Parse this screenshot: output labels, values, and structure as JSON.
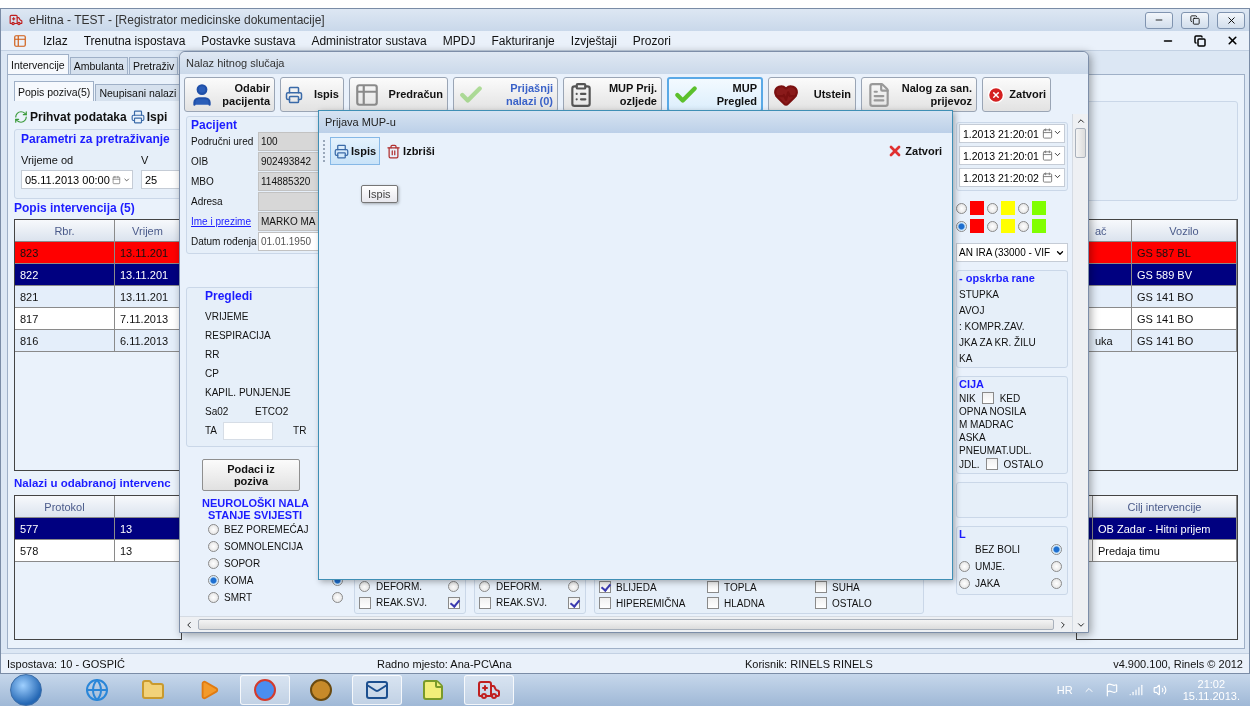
{
  "window": {
    "title": "eHitna - TEST - [Registrator medicinske dokumentacije]"
  },
  "menu": [
    "Izlaz",
    "Trenutna ispostava",
    "Postavke sustava",
    "Administrator sustava",
    "MPDJ",
    "Fakturiranje",
    "Izvještaji",
    "Prozori"
  ],
  "tabs": [
    {
      "label": "Intervencije",
      "selected": true
    },
    {
      "label": "Ambulanta",
      "selected": false
    },
    {
      "label": "Pretraživ",
      "selected": false
    }
  ],
  "subtabs": [
    {
      "label": "Popis poziva(5)",
      "selected": true
    },
    {
      "label": "Neupisani nalazi",
      "selected": false
    }
  ],
  "toolbar": [
    "Prihvat podataka",
    "Ispi"
  ],
  "search_params": {
    "title": "Parametri za pretraživanje",
    "fields": [
      {
        "label": "Vrijeme od",
        "value": "05.11.2013 00:00"
      },
      {
        "label": "V",
        "value": "25"
      }
    ]
  },
  "interventions": {
    "title": "Popis intervencija (5)",
    "columns": [
      "Rbr.",
      "Vrijem",
      "ač",
      "Vozilo"
    ],
    "rows": [
      {
        "rbr": "823",
        "vrijeme": "13.11.201",
        "vozilo": "GS 587 BL",
        "selected": false,
        "color": "#ff0000"
      },
      {
        "rbr": "822",
        "vrijeme": "13.11.201",
        "vozilo": "GS 589 BV",
        "selected": true
      },
      {
        "rbr": "821",
        "vrijeme": "13.11.201",
        "vozilo": "GS 141 BO",
        "selected": false
      },
      {
        "rbr": "817",
        "vrijeme": "7.11.2013",
        "vozilo": "GS 141 BO",
        "selected": false
      },
      {
        "rbr": "816",
        "vrijeme": "6.11.2013",
        "column_3": "uka",
        "vozilo": "GS 141 BO",
        "selected": false
      }
    ]
  },
  "findings": {
    "title": "Nalazi u odabranoj intervenc",
    "columns": [
      "Protokol",
      "Cilj intervencije"
    ],
    "rows": [
      {
        "protokol": "577",
        "column_2": "13",
        "cilj": "OB Zadar - Hitni prijem",
        "selected": true
      },
      {
        "protokol": "578",
        "column_2": "13",
        "cilj": "Predaja timu",
        "selected": false
      }
    ]
  },
  "status_bar": [
    "Ispostava: 10 - GOSPIĆ",
    "Radno mjesto: Ana-PC\\Ana",
    "Korisnik: RINELS RINELS",
    "v4.900.100, Rinels © 2012"
  ],
  "dialog": {
    "title": "Nalaz hitnog slučaja",
    "toolbar": [
      {
        "label": "Odabir pacijenta",
        "disabled": false,
        "selected": false
      },
      {
        "label": "Ispis",
        "disabled": false,
        "selected": false
      },
      {
        "label": "Predračun",
        "disabled": false,
        "selected": false
      },
      {
        "label": "Prijašnji nalazi (0)",
        "disabled": true,
        "selected": false
      },
      {
        "label": "MUP Prij. ozljede",
        "disabled": false,
        "selected": false
      },
      {
        "label": "MUP Pregled",
        "disabled": false,
        "selected": true
      },
      {
        "label": "Utstein",
        "disabled": false,
        "selected": false
      },
      {
        "label": "Nalog za san. prijevoz",
        "disabled": false,
        "selected": false
      },
      {
        "label": "Zatvori",
        "disabled": false,
        "selected": false
      }
    ],
    "patient": {
      "title": "Pacijent",
      "fields": [
        {
          "label": "Područni ured",
          "value": "100",
          "kind": "text"
        },
        {
          "label": "OIB",
          "value": "902493842",
          "kind": "text"
        },
        {
          "label": "MBO",
          "value": "114885320",
          "kind": "text"
        },
        {
          "label": "Adresa",
          "kind": "text"
        },
        {
          "label": "Ime i prezime",
          "value": "MARKO MA",
          "kind": "link"
        },
        {
          "label": "Datum rođenja",
          "value": "01.01.1950",
          "kind": "date"
        }
      ]
    },
    "vitals": {
      "title": "Pregledi",
      "rows": [
        {
          "kind": "text",
          "labels": [
            "VRIJEME"
          ]
        },
        {
          "kind": "text",
          "labels": [
            "RESPIRACIJA"
          ]
        },
        {
          "kind": "text",
          "labels": [
            "RR"
          ]
        },
        {
          "kind": "text",
          "labels": [
            "CP"
          ]
        },
        {
          "kind": "text",
          "labels": [
            "KAPIL. PUNJENJE"
          ]
        },
        {
          "kind": "text",
          "labels": [
            "Sa02",
            "ETCO2"
          ]
        },
        {
          "kind": "field",
          "labels": [
            "TA",
            "TR"
          ]
        }
      ]
    },
    "call_data_button": "Podaci iz poziva",
    "neuro": {
      "title": "NEUROLOŠKI NALA",
      "subtitle": "STANJE SVIJESTI",
      "options": [
        {
          "label": "BEZ POREMEĆAJ",
          "selected": false
        },
        {
          "label": "SOMNOLENCIJA",
          "selected": false
        },
        {
          "label": "SOPOR",
          "selected": false
        },
        {
          "label": "KOMA",
          "selected": true,
          "side": {
            "selected": true
          }
        },
        {
          "label": "SMRT",
          "selected": false,
          "side": {
            "selected": false
          }
        }
      ]
    },
    "pupils": [
      {
        "rows": [
          {
            "kind": "radio",
            "label": "DEFORM.",
            "left": {
              "selected": false
            },
            "right": {
              "selected": false
            }
          },
          {
            "kind": "checkbox",
            "label": "REAK.SVJ.",
            "left": {
              "checked": false
            },
            "right": {
              "checked": true
            }
          }
        ]
      },
      {
        "rows": [
          {
            "kind": "radio",
            "label": "DEFORM.",
            "left": {
              "selected": false
            },
            "right": {
              "selected": false
            }
          },
          {
            "kind": "checkbox",
            "label": "REAK.SVJ.",
            "left": {
              "checked": false
            },
            "right": {
              "checked": true
            }
          }
        ]
      }
    ],
    "skin": [
      {
        "label": "BLIJEDA",
        "checked": true
      },
      {
        "label": "HIPEREMIČNA",
        "checked": false
      },
      {
        "label": "TOPLA",
        "checked": false
      },
      {
        "label": "HLADNA",
        "checked": false
      },
      {
        "label": "SUHA",
        "checked": false
      },
      {
        "label": "OSTALO",
        "checked": false
      }
    ],
    "times": [
      "1.2013 21:20:01",
      "1.2013 21:20:01",
      "1.2013 21:20:02"
    ],
    "triage": [
      {
        "options": [
          {
            "selected": false,
            "color": "#ff0000"
          },
          {
            "selected": false,
            "color": "#ffff00"
          },
          {
            "selected": false,
            "color": "#80ff00"
          }
        ]
      },
      {
        "options": [
          {
            "selected": true,
            "color": "#ff0000"
          },
          {
            "selected": false,
            "color": "#ffff00"
          },
          {
            "selected": false,
            "color": "#80ff00"
          }
        ]
      }
    ],
    "dropdown": "AN IRA (33000 - VIF",
    "wound": {
      "title": "- opskrba rane",
      "items": [
        "STUPKA",
        "AVOJ",
        ": KOMPR.ZAV.",
        "JKA ZA KR. ŽILU",
        "KA"
      ]
    },
    "immobilization": {
      "title": "CIJA",
      "rows": [
        {
          "label": "NIK",
          "checkbox": {
            "label": "KED",
            "checked": false
          }
        },
        {
          "label": "OPNA NOSILA"
        },
        {
          "label": "M MADRAC"
        },
        {
          "label": "ASKA"
        },
        {
          "label": "PNEUMAT.UDL."
        },
        {
          "label": "JDL.",
          "checkbox": {
            "label": "OSTALO",
            "checked": false
          }
        }
      ]
    },
    "pain": {
      "title": "L",
      "rows": [
        {
          "label": "BEZ BOLI",
          "radios": [
            {
              "selected": true
            }
          ]
        },
        {
          "label": "UMJE.",
          "radios": [
            {
              "selected": false
            },
            {
              "selected": false
            }
          ]
        },
        {
          "label": "JAKA",
          "radios": [
            {
              "selected": false
            },
            {
              "selected": false
            }
          ]
        }
      ]
    },
    "mup_window": {
      "title": "Prijava MUP-u",
      "toolbar": [
        {
          "label": "Ispis",
          "hovered": true
        },
        {
          "label": "Izbriši",
          "hovered": false
        }
      ],
      "close": "Zatvori",
      "tooltip": "Ispis"
    }
  },
  "taskbar": {
    "apps": [
      {
        "kind": "ie",
        "open": false
      },
      {
        "kind": "folder",
        "open": false
      },
      {
        "kind": "media",
        "open": false
      },
      {
        "kind": "chrome",
        "open": true
      },
      {
        "kind": "winamp",
        "open": false
      },
      {
        "kind": "mail",
        "open": true
      },
      {
        "kind": "notes",
        "open": false
      },
      {
        "kind": "ambulance",
        "open": true
      }
    ],
    "language": "HR",
    "time": "21:02",
    "date": "15.11.2013."
  }
}
